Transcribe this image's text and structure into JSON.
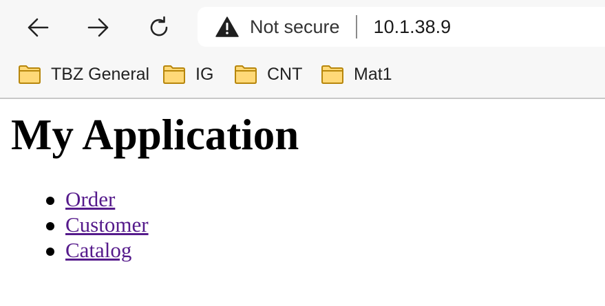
{
  "browser": {
    "security_label": "Not secure",
    "url": "10.1.38.9",
    "warning_icon": "warning-triangle-icon",
    "nav_icons": [
      "back-arrow-icon",
      "forward-arrow-icon",
      "reload-icon"
    ],
    "bookmarks": [
      {
        "label": "TBZ General",
        "icon": "folder-icon"
      },
      {
        "label": "IG",
        "icon": "folder-icon"
      },
      {
        "label": "CNT",
        "icon": "folder-icon"
      },
      {
        "label": "Mat1",
        "icon": "folder-icon"
      }
    ],
    "colors": {
      "folder_fill": "#ffd978",
      "folder_stroke": "#b7860b",
      "visited_link": "#551a8b"
    }
  },
  "page": {
    "title": "My Application",
    "links": [
      {
        "label": "Order"
      },
      {
        "label": "Customer"
      },
      {
        "label": "Catalog"
      }
    ]
  }
}
